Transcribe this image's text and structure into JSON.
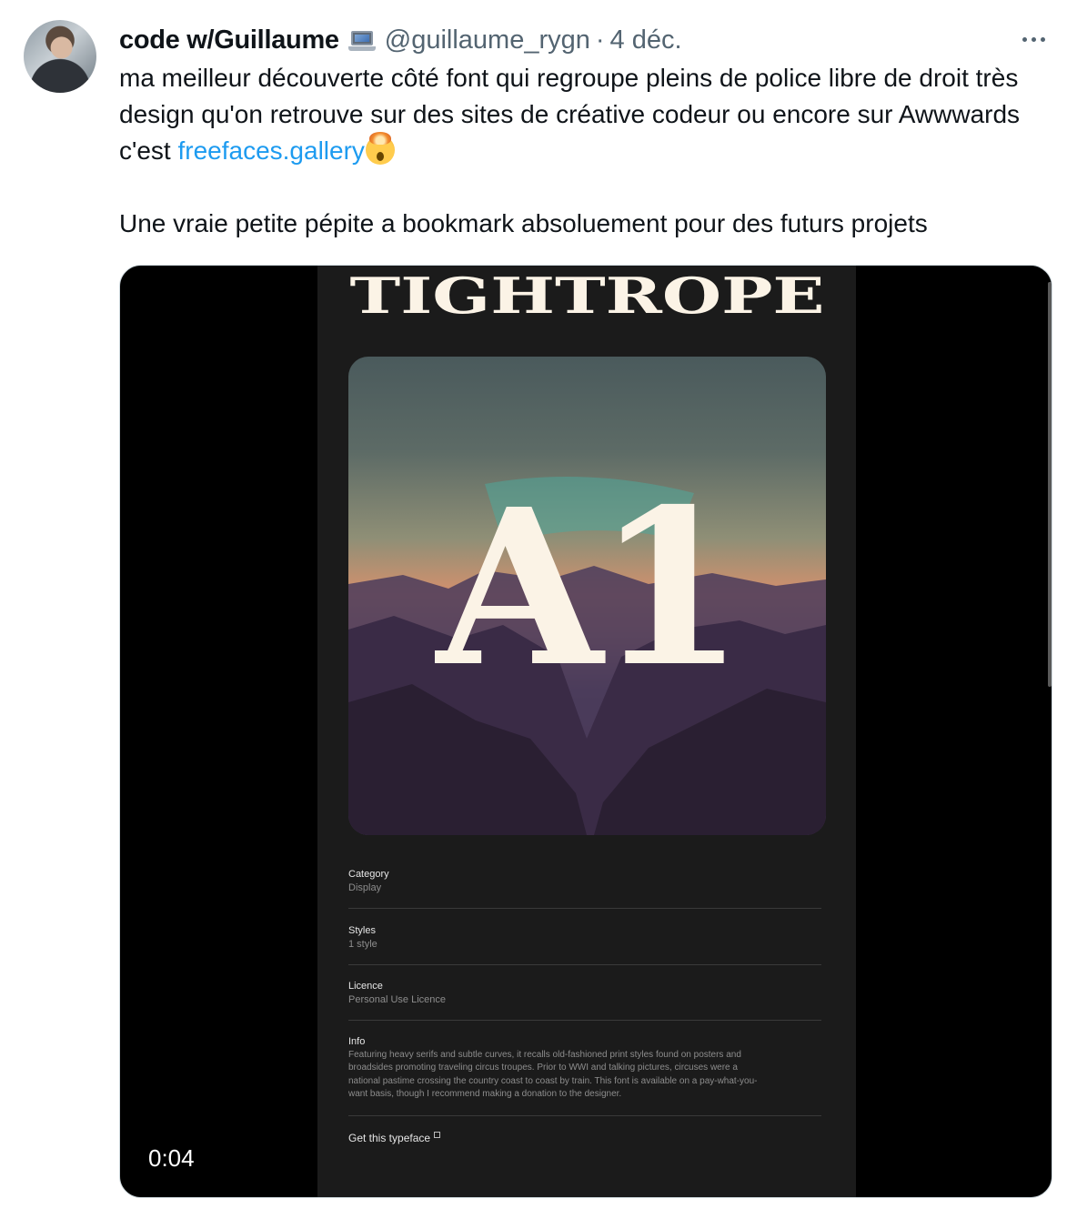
{
  "tweet": {
    "author_name": "code w/Guillaume",
    "author_emoji_icon": "laptop-icon",
    "handle": "@guillaume_rygn",
    "separator": "·",
    "date": "4 déc.",
    "text_part1": "ma meilleur découverte côté font qui regroupe pleins de police libre de droit très design qu'on retrouve sur des sites de créative codeur ou encore sur Awwwards c'est ",
    "link_text": "freefaces.gallery",
    "trailing_emoji_icon": "exploding-head-icon",
    "text_part2": "Une vraie petite pépite a bookmark absoluement pour des futurs projets"
  },
  "video": {
    "timestamp": "0:04",
    "font_name": "TIGHTROPE",
    "specimen_glyph": "A1",
    "details": [
      {
        "label": "Category",
        "value": "Display"
      },
      {
        "label": "Styles",
        "value": "1 style"
      },
      {
        "label": "Licence",
        "value": "Personal Use Licence"
      }
    ],
    "info_label": "Info",
    "info_lines": [
      "Featuring heavy serifs and subtle curves, it recalls old-fashioned print styles found on posters and",
      "broadsides promoting traveling circus troupes. Prior to WWI and talking pictures, circuses were a",
      "national pastime crossing the country coast to coast by train. This font is available on a pay-what-you-",
      "want basis, though I recommend making a donation to the designer."
    ],
    "cta_label": "Get this typeface"
  },
  "colors": {
    "link": "#1d9bf0",
    "text": "#0f1419",
    "secondary": "#536471"
  }
}
